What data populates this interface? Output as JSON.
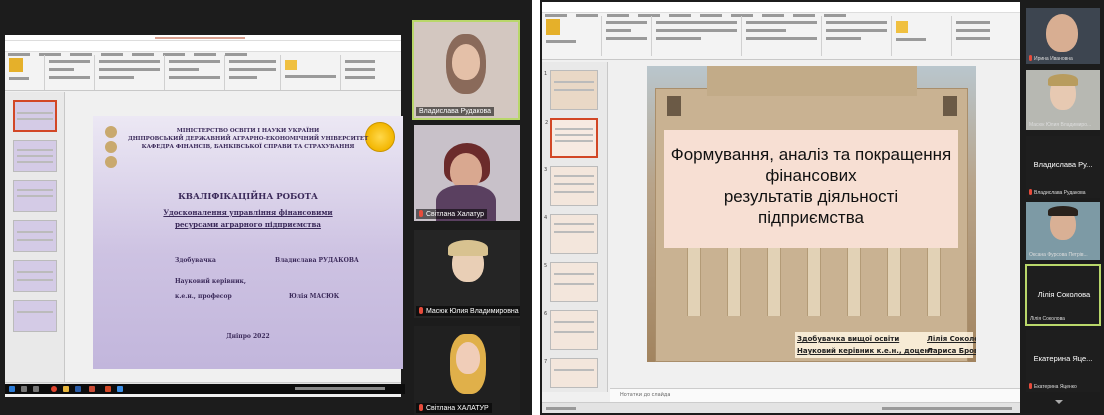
{
  "left_slide": {
    "ministry": [
      "МІНІСТЕРСТВО ОСВІТИ І НАУКИ УКРАЇНИ",
      "ДНІПРОВСЬКИЙ ДЕРЖАВНИЙ АГРАРНО-ЕКОНОМІЧНИЙ УНІВЕРСИТЕТ",
      "КАФЕДРА ФІНАНСІВ, БАНКІВСЬКОЇ СПРАВИ ТА СТРАХУВАННЯ"
    ],
    "title": "КВАЛІФІКАЦІЙНА РОБОТА",
    "subtitle": [
      "Удосконалення управління фінансовими",
      "ресурсами аграрного підприємства"
    ],
    "applicant_label": "Здобувачка",
    "applicant_name": "Владислава РУДАКОВА",
    "advisor_label": [
      "Науковий керівник,",
      "к.е.н., професор"
    ],
    "advisor_name": "Юлія МАСЮК",
    "city_year": "Дніпро 2022"
  },
  "left_participants": [
    {
      "name": "Владислава Рудакова",
      "active": true
    },
    {
      "name": "Світлана Халатур",
      "active": false
    },
    {
      "name": "Масюк Юлия Владимировна",
      "active": false
    },
    {
      "name": "Світлана ХАЛАТУР",
      "active": false
    }
  ],
  "right_slide": {
    "title_lines": [
      "Формування, аналіз та покращення",
      "фінансових",
      "результатів діяльності",
      "підприємства"
    ],
    "applicant_label": "Здобувачка вищої освіти",
    "applicant_name": "Лілія Соколова",
    "advisor_label": "Науковий керівник к.е.н., доцент",
    "advisor_name": "Лариса Бровко"
  },
  "right_notes": "Нотатки до слайда",
  "right_participants": [
    {
      "name": "",
      "sub": "Ирина Ивановна",
      "type": "video"
    },
    {
      "name": "",
      "sub": "Масюк Юлия Владимиро...",
      "type": "video"
    },
    {
      "name": "Владислава Ру...",
      "sub": "Владислава Рудакова",
      "type": "name"
    },
    {
      "name": "",
      "sub": "Оксана Фурсова Петрів...",
      "type": "video"
    },
    {
      "name": "Лілія Соколова",
      "sub": "Лілія Соколова",
      "type": "name",
      "active": true
    },
    {
      "name": "Екатерина Яце...",
      "sub": "Екатерина Яценко",
      "type": "name"
    }
  ],
  "colors": {
    "accent_active": "#b9d76a",
    "mic_muted": "#e74c3c",
    "ppt_orange": "#d24726"
  }
}
